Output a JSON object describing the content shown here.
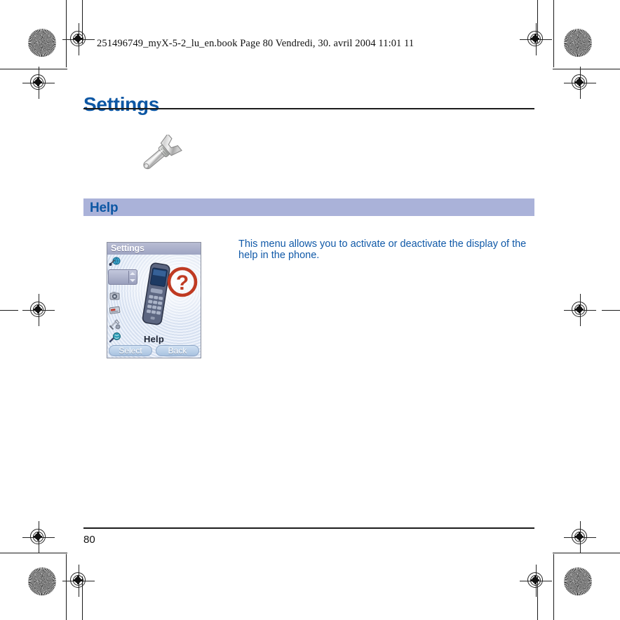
{
  "document": {
    "header_line": "251496749_myX-5-2_lu_en.book  Page 80  Vendredi, 30. avril 2004  11:01 11",
    "chapter_title": "Settings",
    "chapter_icon": "wrench-icon",
    "page_number": "80"
  },
  "section": {
    "heading": "Help",
    "band_color": "#aab2d9",
    "heading_color": "#0d57a4",
    "body_text": "This menu allows you to activate or deactivate the display of the help in the phone."
  },
  "phone_screenshot": {
    "title_bar": "Settings",
    "selected_label": "Help",
    "softkey_left": "Select",
    "softkey_right": "Back",
    "question_mark": "?",
    "accent_red": "#bf3a22",
    "icons": [
      {
        "name": "network-globe-icon"
      },
      {
        "name": "help-phone-icon"
      },
      {
        "name": "camera-icon"
      },
      {
        "name": "card-icon"
      },
      {
        "name": "tools-icon"
      },
      {
        "name": "connectivity-icon"
      }
    ]
  },
  "colors": {
    "title_blue": "#0d57a4",
    "body_blue": "#1059a8",
    "rule_black": "#1c1c1c"
  }
}
